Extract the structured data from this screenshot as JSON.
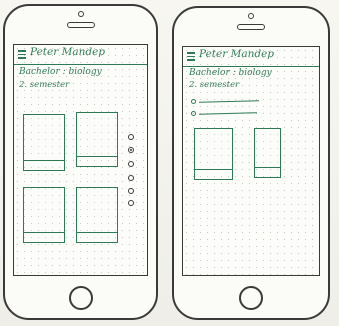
{
  "header": {
    "title": "Peter Mandep"
  },
  "left_screen": {
    "line1": "Bachelor : biology",
    "line2": "2. semester"
  },
  "right_screen": {
    "line1": "Bachelor : biology",
    "line2": "2. semester"
  },
  "pagination": {
    "total_dots": 6,
    "selected_index": 1
  },
  "colors": {
    "ink": "#2f7a56",
    "outline": "#3a3a3a"
  }
}
